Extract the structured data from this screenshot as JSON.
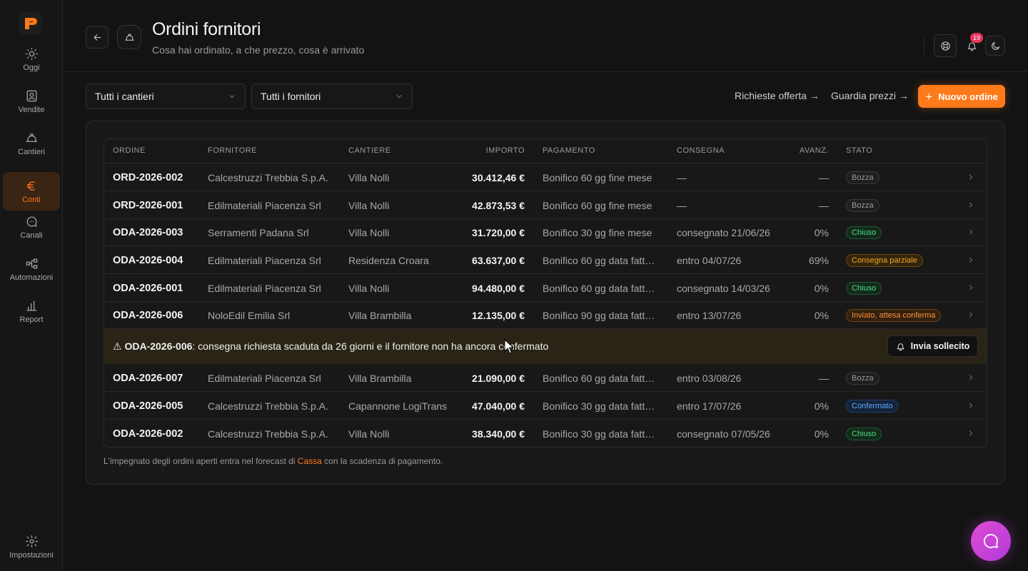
{
  "sidebar": {
    "items": [
      {
        "label": "Oggi",
        "icon": "sun-icon",
        "active": false
      },
      {
        "label": "Vendite",
        "icon": "contact-card-icon",
        "active": false
      },
      {
        "label": "Cantieri",
        "icon": "hardhat-icon",
        "active": false
      },
      {
        "label": "Conti",
        "icon": "euro-icon",
        "active": true
      },
      {
        "label": "Canali",
        "icon": "chat-bubble-icon",
        "active": false
      },
      {
        "label": "Automazioni",
        "icon": "workflow-icon",
        "active": false
      },
      {
        "label": "Report",
        "icon": "bar-chart-icon",
        "active": false
      }
    ],
    "settings_label": "Impostazioni"
  },
  "header": {
    "title": "Ordini fornitori",
    "subtitle": "Cosa hai ordinato, a che prezzo, cosa è arrivato",
    "notification_count": "19"
  },
  "filters": {
    "site": "Tutti i cantieri",
    "supplier": "Tutti i fornitori"
  },
  "actions": {
    "rfq_link": "Richieste offerta →",
    "price_link": "Guardia prezzi →",
    "new_order": "Nuovo ordine"
  },
  "table": {
    "columns": {
      "order": "ORDINE",
      "supplier": "FORNITORE",
      "site": "CANTIERE",
      "amount": "IMPORTO",
      "payment": "PAGAMENTO",
      "delivery": "CONSEGNA",
      "progress": "AVANZ.",
      "status": "STATO"
    },
    "rows": [
      {
        "id": "ORD-2026-002",
        "supplier": "Calcestruzzi Trebbia S.p.A.",
        "site": "Villa Nolli",
        "amount": "30.412,46 €",
        "payment": "Bonifico 60 gg fine mese",
        "delivery": "—",
        "progress": "—",
        "status": "Bozza"
      },
      {
        "id": "ORD-2026-001",
        "supplier": "Edilmateriali Piacenza Srl",
        "site": "Villa Nolli",
        "amount": "42.873,53 €",
        "payment": "Bonifico 60 gg fine mese",
        "delivery": "—",
        "progress": "—",
        "status": "Bozza"
      },
      {
        "id": "ODA-2026-003",
        "supplier": "Serramenti Padana Srl",
        "site": "Villa Nolli",
        "amount": "31.720,00 €",
        "payment": "Bonifico 30 gg fine mese",
        "delivery": "consegnato 21/06/26",
        "progress": "0%",
        "status": "Chiuso"
      },
      {
        "id": "ODA-2026-004",
        "supplier": "Edilmateriali Piacenza Srl",
        "site": "Residenza Croara",
        "amount": "63.637,00 €",
        "payment": "Bonifico 60 gg data fatt…",
        "delivery": "entro 04/07/26",
        "progress": "69%",
        "status": "Consegna parziale"
      },
      {
        "id": "ODA-2026-001",
        "supplier": "Edilmateriali Piacenza Srl",
        "site": "Villa Nolli",
        "amount": "94.480,00 €",
        "payment": "Bonifico 60 gg data fatt…",
        "delivery": "consegnato 14/03/26",
        "progress": "0%",
        "status": "Chiuso"
      },
      {
        "id": "ODA-2026-006",
        "supplier": "NoloEdil Emilia Srl",
        "site": "Villa Brambilla",
        "amount": "12.135,00 €",
        "payment": "Bonifico 90 gg data fatt…",
        "delivery": "entro 13/07/26",
        "progress": "0%",
        "status": "Inviato, attesa conferma"
      },
      {
        "id": "ODA-2026-007",
        "supplier": "Edilmateriali Piacenza Srl",
        "site": "Villa Brambilla",
        "amount": "21.090,00 €",
        "payment": "Bonifico 60 gg data fatt…",
        "delivery": "entro 03/08/26",
        "progress": "—",
        "status": "Bozza"
      },
      {
        "id": "ODA-2026-005",
        "supplier": "Calcestruzzi Trebbia S.p.A.",
        "site": "Capannone LogiTrans",
        "amount": "47.040,00 €",
        "payment": "Bonifico 30 gg data fatt…",
        "delivery": "entro 17/07/26",
        "progress": "0%",
        "status": "Confermato"
      },
      {
        "id": "ODA-2026-002",
        "supplier": "Calcestruzzi Trebbia S.p.A.",
        "site": "Villa Nolli",
        "amount": "38.340,00 €",
        "payment": "Bonifico 30 gg data fatt…",
        "delivery": "consegnato 07/05/26",
        "progress": "0%",
        "status": "Chiuso"
      }
    ],
    "alert": {
      "prefix": "⚠",
      "order_id": "ODA-2026-006",
      "message": ": consegna richiesta scaduta da 26 giorni e il fornitore non ha ancora confermato",
      "button": "Invia sollecito"
    }
  },
  "status_colors": {
    "Bozza": {
      "fg": "#9a9a9a",
      "bg": "#1f1f1f",
      "border": "#3a3a3a"
    },
    "Chiuso": {
      "fg": "#4ade80",
      "bg": "#132a1b",
      "border": "#1f5a33"
    },
    "Consegna parziale": {
      "fg": "#f5a524",
      "bg": "#33250d",
      "border": "#6b4a12"
    },
    "Inviato, attesa conferma": {
      "fg": "#fb923c",
      "bg": "#33200f",
      "border": "#6e3d14"
    },
    "Confermato": {
      "fg": "#60a5fa",
      "bg": "#13233a",
      "border": "#1e4271"
    }
  },
  "footnote": {
    "before": "L'impegnato degli ordini aperti entra nel forecast di ",
    "link": "Cassa",
    "after": " con la scadenza di pagamento."
  },
  "accent_color": "#ff7a1a"
}
